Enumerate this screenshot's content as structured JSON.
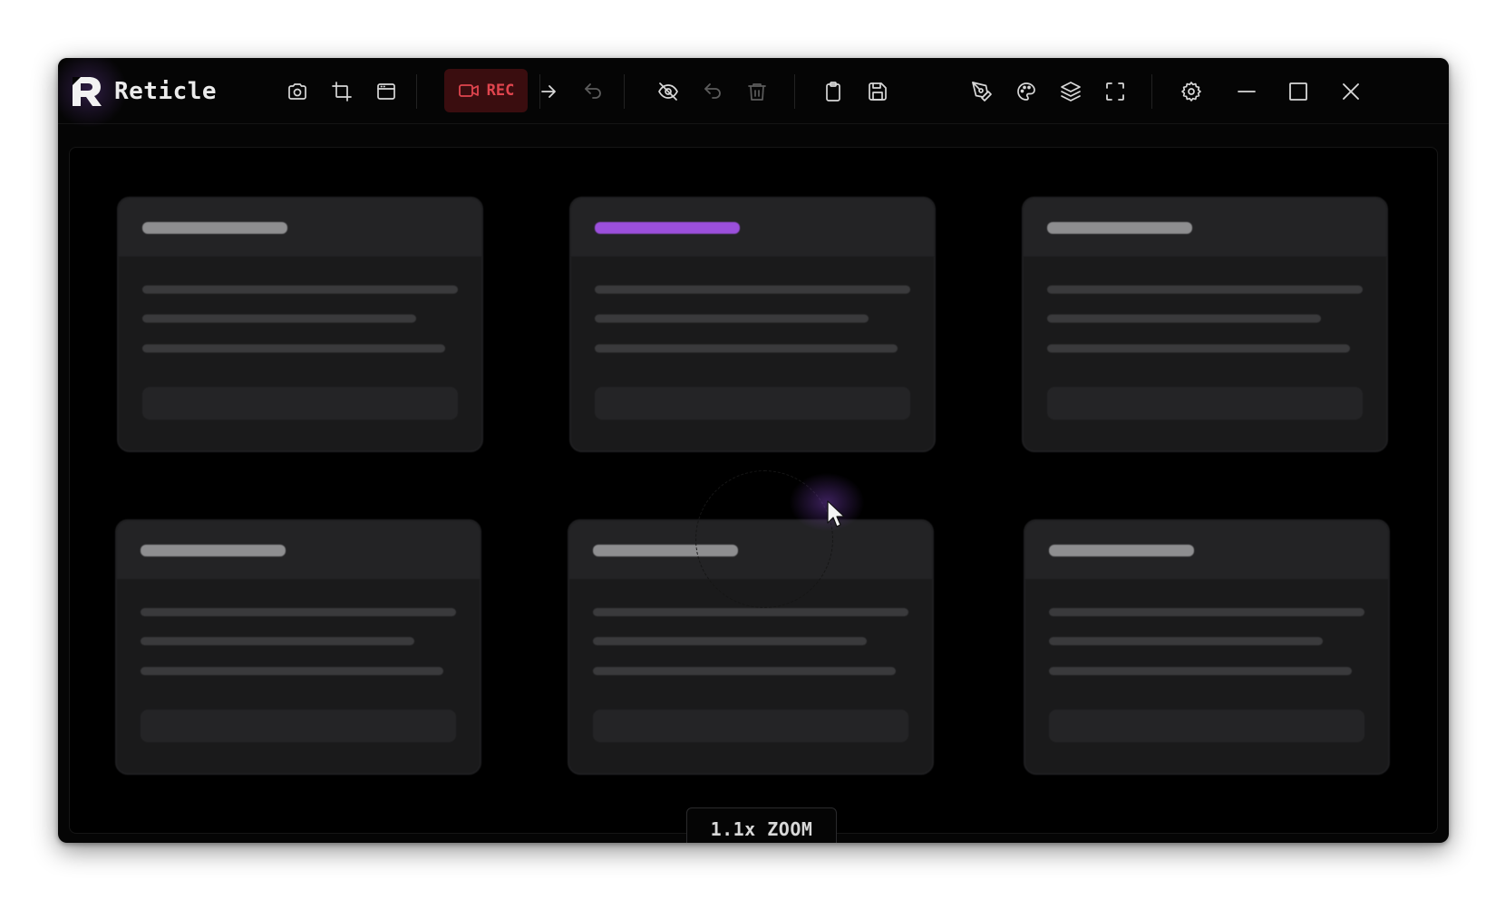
{
  "app": {
    "title": "Reticle",
    "logo_icon": "reticle-logo-icon"
  },
  "toolbar": {
    "groups": [
      [
        "camera-icon",
        "crop-icon",
        "window-icon"
      ],
      [
        "arrow-right-icon",
        "undo-icon"
      ],
      [
        "eye-off-icon",
        "undo-icon",
        "trash-icon"
      ],
      [
        "clipboard-icon",
        "save-icon"
      ],
      [
        "pen-tool-icon",
        "palette-icon",
        "layers-icon",
        "fullscreen-icon"
      ],
      [
        "gear-icon"
      ]
    ],
    "record": {
      "label": "REC",
      "icon": "video-camera-icon",
      "color": "#e0454e",
      "background": "#3a0d0f"
    },
    "window_controls": [
      "minimize-icon",
      "maximize-icon",
      "close-icon"
    ]
  },
  "canvas": {
    "cards": [
      {
        "accent": false
      },
      {
        "accent": true
      },
      {
        "accent": false
      },
      {
        "accent": false
      },
      {
        "accent": false
      },
      {
        "accent": false
      }
    ],
    "accent_color": "#9b4fdc",
    "cursor_icon": "pointer-cursor-icon"
  },
  "zoom": {
    "label": "1.1x ZOOM"
  }
}
